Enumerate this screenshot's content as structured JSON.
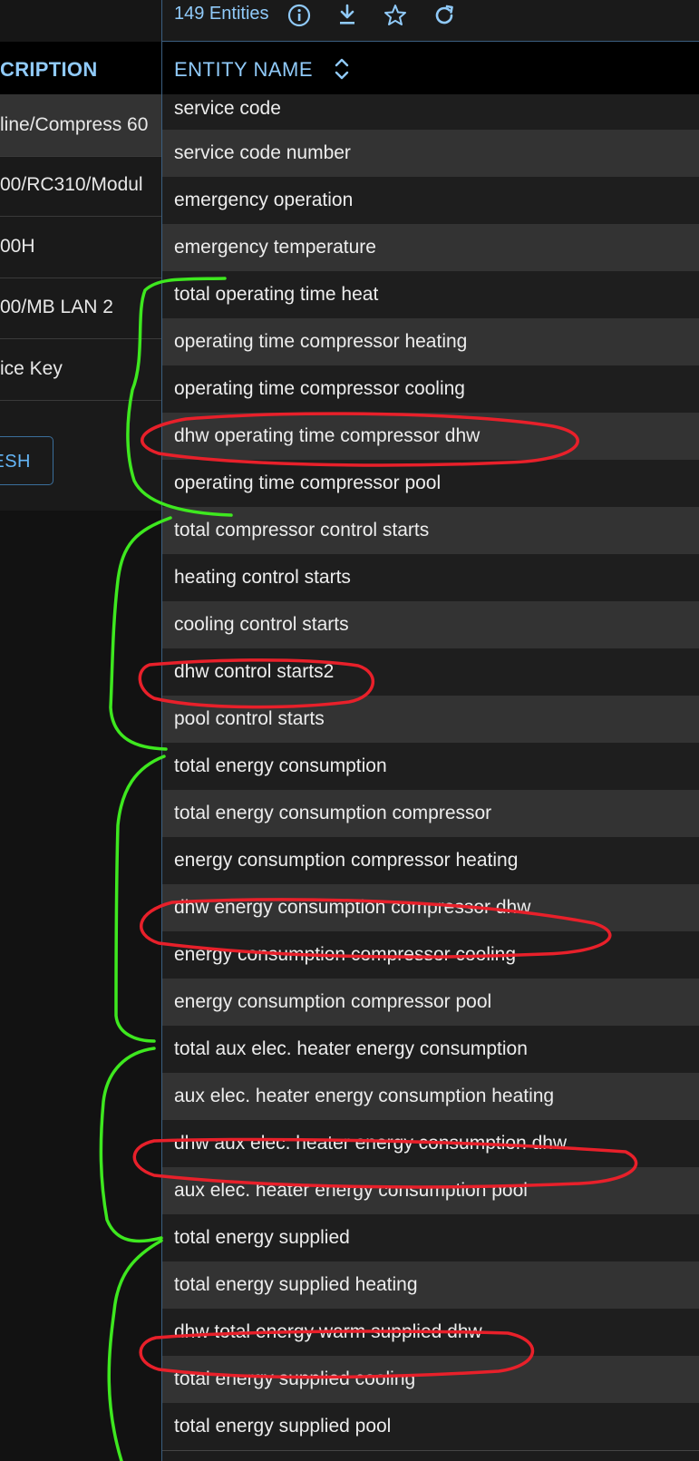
{
  "toolbar": {
    "entity_count": "149 Entities",
    "icons": [
      "info-icon",
      "download-icon",
      "star-icon",
      "refresh-icon"
    ]
  },
  "devices_panel": {
    "column_header": "CRIPTION",
    "rows": [
      {
        "label": "line/Compress 60"
      },
      {
        "label": "00/RC310/Modul"
      },
      {
        "label": "00H"
      },
      {
        "label": "00/MB LAN 2"
      },
      {
        "label": "ice Key"
      }
    ],
    "refresh_label": "ESH"
  },
  "entities_panel": {
    "column_header": "ENTITY NAME",
    "rows": [
      {
        "name": "service code"
      },
      {
        "name": "service code number"
      },
      {
        "name": "emergency operation"
      },
      {
        "name": "emergency temperature"
      },
      {
        "name": "total operating time heat"
      },
      {
        "name": "operating time compressor heating"
      },
      {
        "name": "operating time compressor cooling"
      },
      {
        "name": "dhw operating time compressor dhw"
      },
      {
        "name": "operating time compressor pool"
      },
      {
        "name": "total compressor control starts"
      },
      {
        "name": "heating control starts"
      },
      {
        "name": "cooling control starts"
      },
      {
        "name": "dhw control starts2"
      },
      {
        "name": "pool control starts"
      },
      {
        "name": "total energy consumption"
      },
      {
        "name": "total energy consumption compressor"
      },
      {
        "name": "energy consumption compressor heating"
      },
      {
        "name": "dhw energy consumption compressor dhw"
      },
      {
        "name": "energy consumption compressor cooling"
      },
      {
        "name": "energy consumption compressor pool"
      },
      {
        "name": "total aux elec. heater energy consumption"
      },
      {
        "name": "aux elec. heater energy consumption heating"
      },
      {
        "name": "dhw aux elec. heater energy consumption dhw"
      },
      {
        "name": "aux elec. heater energy consumption pool"
      },
      {
        "name": "total energy supplied"
      },
      {
        "name": "total energy supplied heating"
      },
      {
        "name": "dhw total energy warm supplied dhw"
      },
      {
        "name": "total energy supplied cooling"
      },
      {
        "name": "total energy supplied pool"
      }
    ]
  },
  "colors": {
    "accent": "#90caf9",
    "annotation_red": "#e8202a",
    "annotation_green": "#3ee81f"
  }
}
